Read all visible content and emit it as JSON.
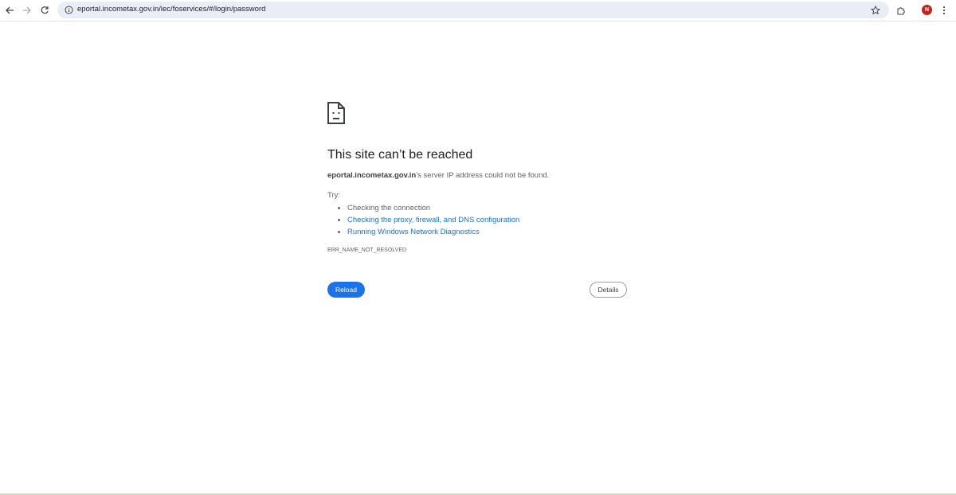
{
  "toolbar": {
    "url": "eportal.incometax.gov.in/iec/foservices/#/login/password",
    "avatar_letter": "N",
    "icons": [
      "back-arrow-icon",
      "forward-arrow-icon",
      "reload-icon",
      "site-info-icon",
      "star-bookmark-icon",
      "extensions-puzzle-icon",
      "kebab-menu-icon"
    ]
  },
  "error_page": {
    "icon": "sad-document-icon",
    "heading": "This site can’t be reached",
    "host": "eportal.incometax.gov.in",
    "message_suffix": "’s server IP address could not be found.",
    "try_label": "Try:",
    "suggestions": [
      "Checking the connection",
      "Checking the proxy, firewall, and DNS configuration",
      "Running Windows Network Diagnostics"
    ],
    "error_code": "ERR_NAME_NOT_RESOLVED",
    "reload_label": "Reload",
    "details_label": "Details"
  },
  "colors": {
    "accent": "#1a73e8",
    "omnibox_bg": "#e9eef6",
    "avatar_bg": "#c5221f",
    "text_secondary": "#5f6368"
  }
}
